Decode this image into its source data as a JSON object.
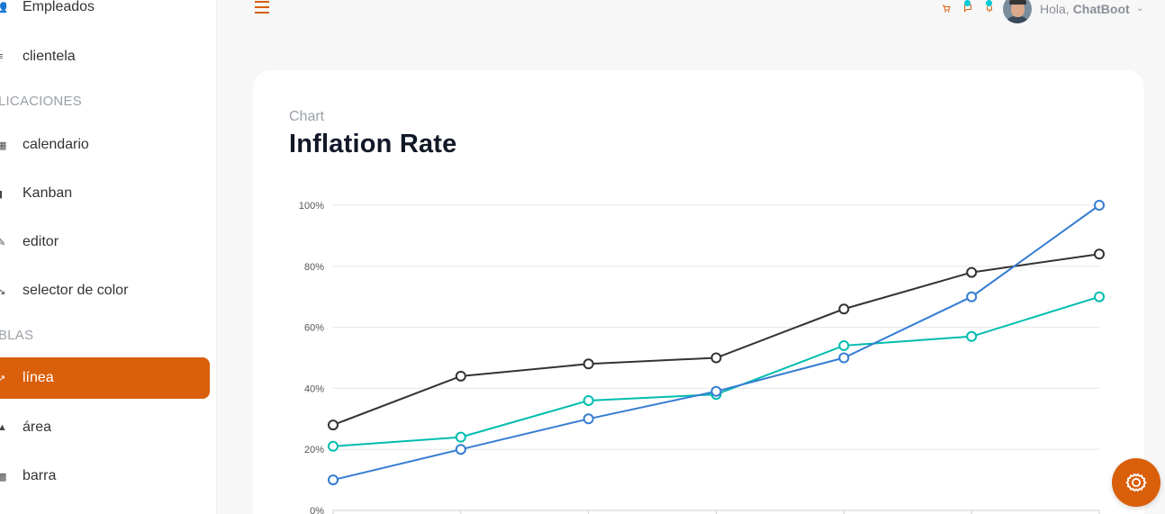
{
  "sidebar": {
    "items": [
      {
        "label": "Empleados",
        "icon": "people-icon"
      },
      {
        "label": "clientela",
        "icon": "list-icon"
      },
      {
        "label": "calendario",
        "icon": "calendar-icon"
      },
      {
        "label": "Kanban",
        "icon": "board-icon"
      },
      {
        "label": "editor",
        "icon": "edit-icon"
      },
      {
        "label": "selector de color",
        "icon": "color-picker-icon"
      },
      {
        "label": "línea",
        "icon": "line-chart-icon"
      },
      {
        "label": "área",
        "icon": "area-chart-icon"
      },
      {
        "label": "barra",
        "icon": "bar-chart-icon"
      }
    ],
    "sections": [
      "LICACIONES",
      "BLAS"
    ]
  },
  "header": {
    "greeting": "Hola,",
    "user": "ChatBoot"
  },
  "card": {
    "subtitle": "Chart",
    "title": "Inflation Rate"
  },
  "colors": {
    "accent": "#d95f0a",
    "notification_dot": "#03c9d7"
  },
  "chart_data": {
    "type": "line",
    "title": "Inflation Rate",
    "x_count": 7,
    "ylim": [
      0,
      100
    ],
    "y_ticks": [
      "0%",
      "20%",
      "40%",
      "60%",
      "80%",
      "100%"
    ],
    "grid": true,
    "series": [
      {
        "color": "#333333",
        "values": [
          28,
          44,
          48,
          50,
          66,
          78,
          84
        ]
      },
      {
        "color": "#00bdae",
        "values": [
          21,
          24,
          36,
          38,
          54,
          57,
          70
        ]
      },
      {
        "color": "#357cd2",
        "values": [
          10,
          20,
          30,
          39,
          50,
          70,
          100
        ]
      }
    ]
  }
}
